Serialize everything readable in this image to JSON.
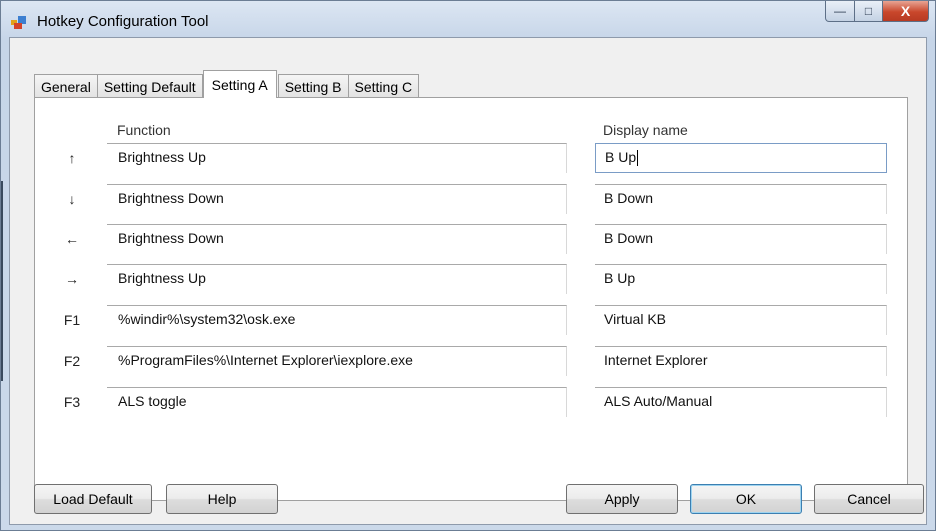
{
  "window": {
    "title": "Hotkey Configuration Tool"
  },
  "caption": {
    "min": "—",
    "max": "□",
    "close": "X"
  },
  "tabs": [
    "General",
    "Setting Default",
    "Setting A",
    "Setting B",
    "Setting C"
  ],
  "active_tab": "Setting A",
  "headers": {
    "function": "Function",
    "display": "Display name"
  },
  "rows": [
    {
      "key": "↑",
      "function": "Brightness Up",
      "display": "B Up"
    },
    {
      "key": "↓",
      "function": "Brightness Down",
      "display": "B Down"
    },
    {
      "key": "←",
      "function": "Brightness Down",
      "display": "B Down"
    },
    {
      "key": "→",
      "function": "Brightness Up",
      "display": "B Up"
    },
    {
      "key": "F1",
      "function": "%windir%\\system32\\osk.exe",
      "display": "Virtual KB"
    },
    {
      "key": "F2",
      "function": "%ProgramFiles%\\Internet Explorer\\iexplore.exe",
      "display": "Internet Explorer"
    },
    {
      "key": "F3",
      "function": "ALS toggle",
      "display": "ALS Auto/Manual"
    }
  ],
  "buttons": {
    "load_default": "Load Default",
    "help": "Help",
    "apply": "Apply",
    "ok": "OK",
    "cancel": "Cancel"
  },
  "colors": {
    "focus_border": "#7a9cc6",
    "close_button": "#c9472c"
  }
}
